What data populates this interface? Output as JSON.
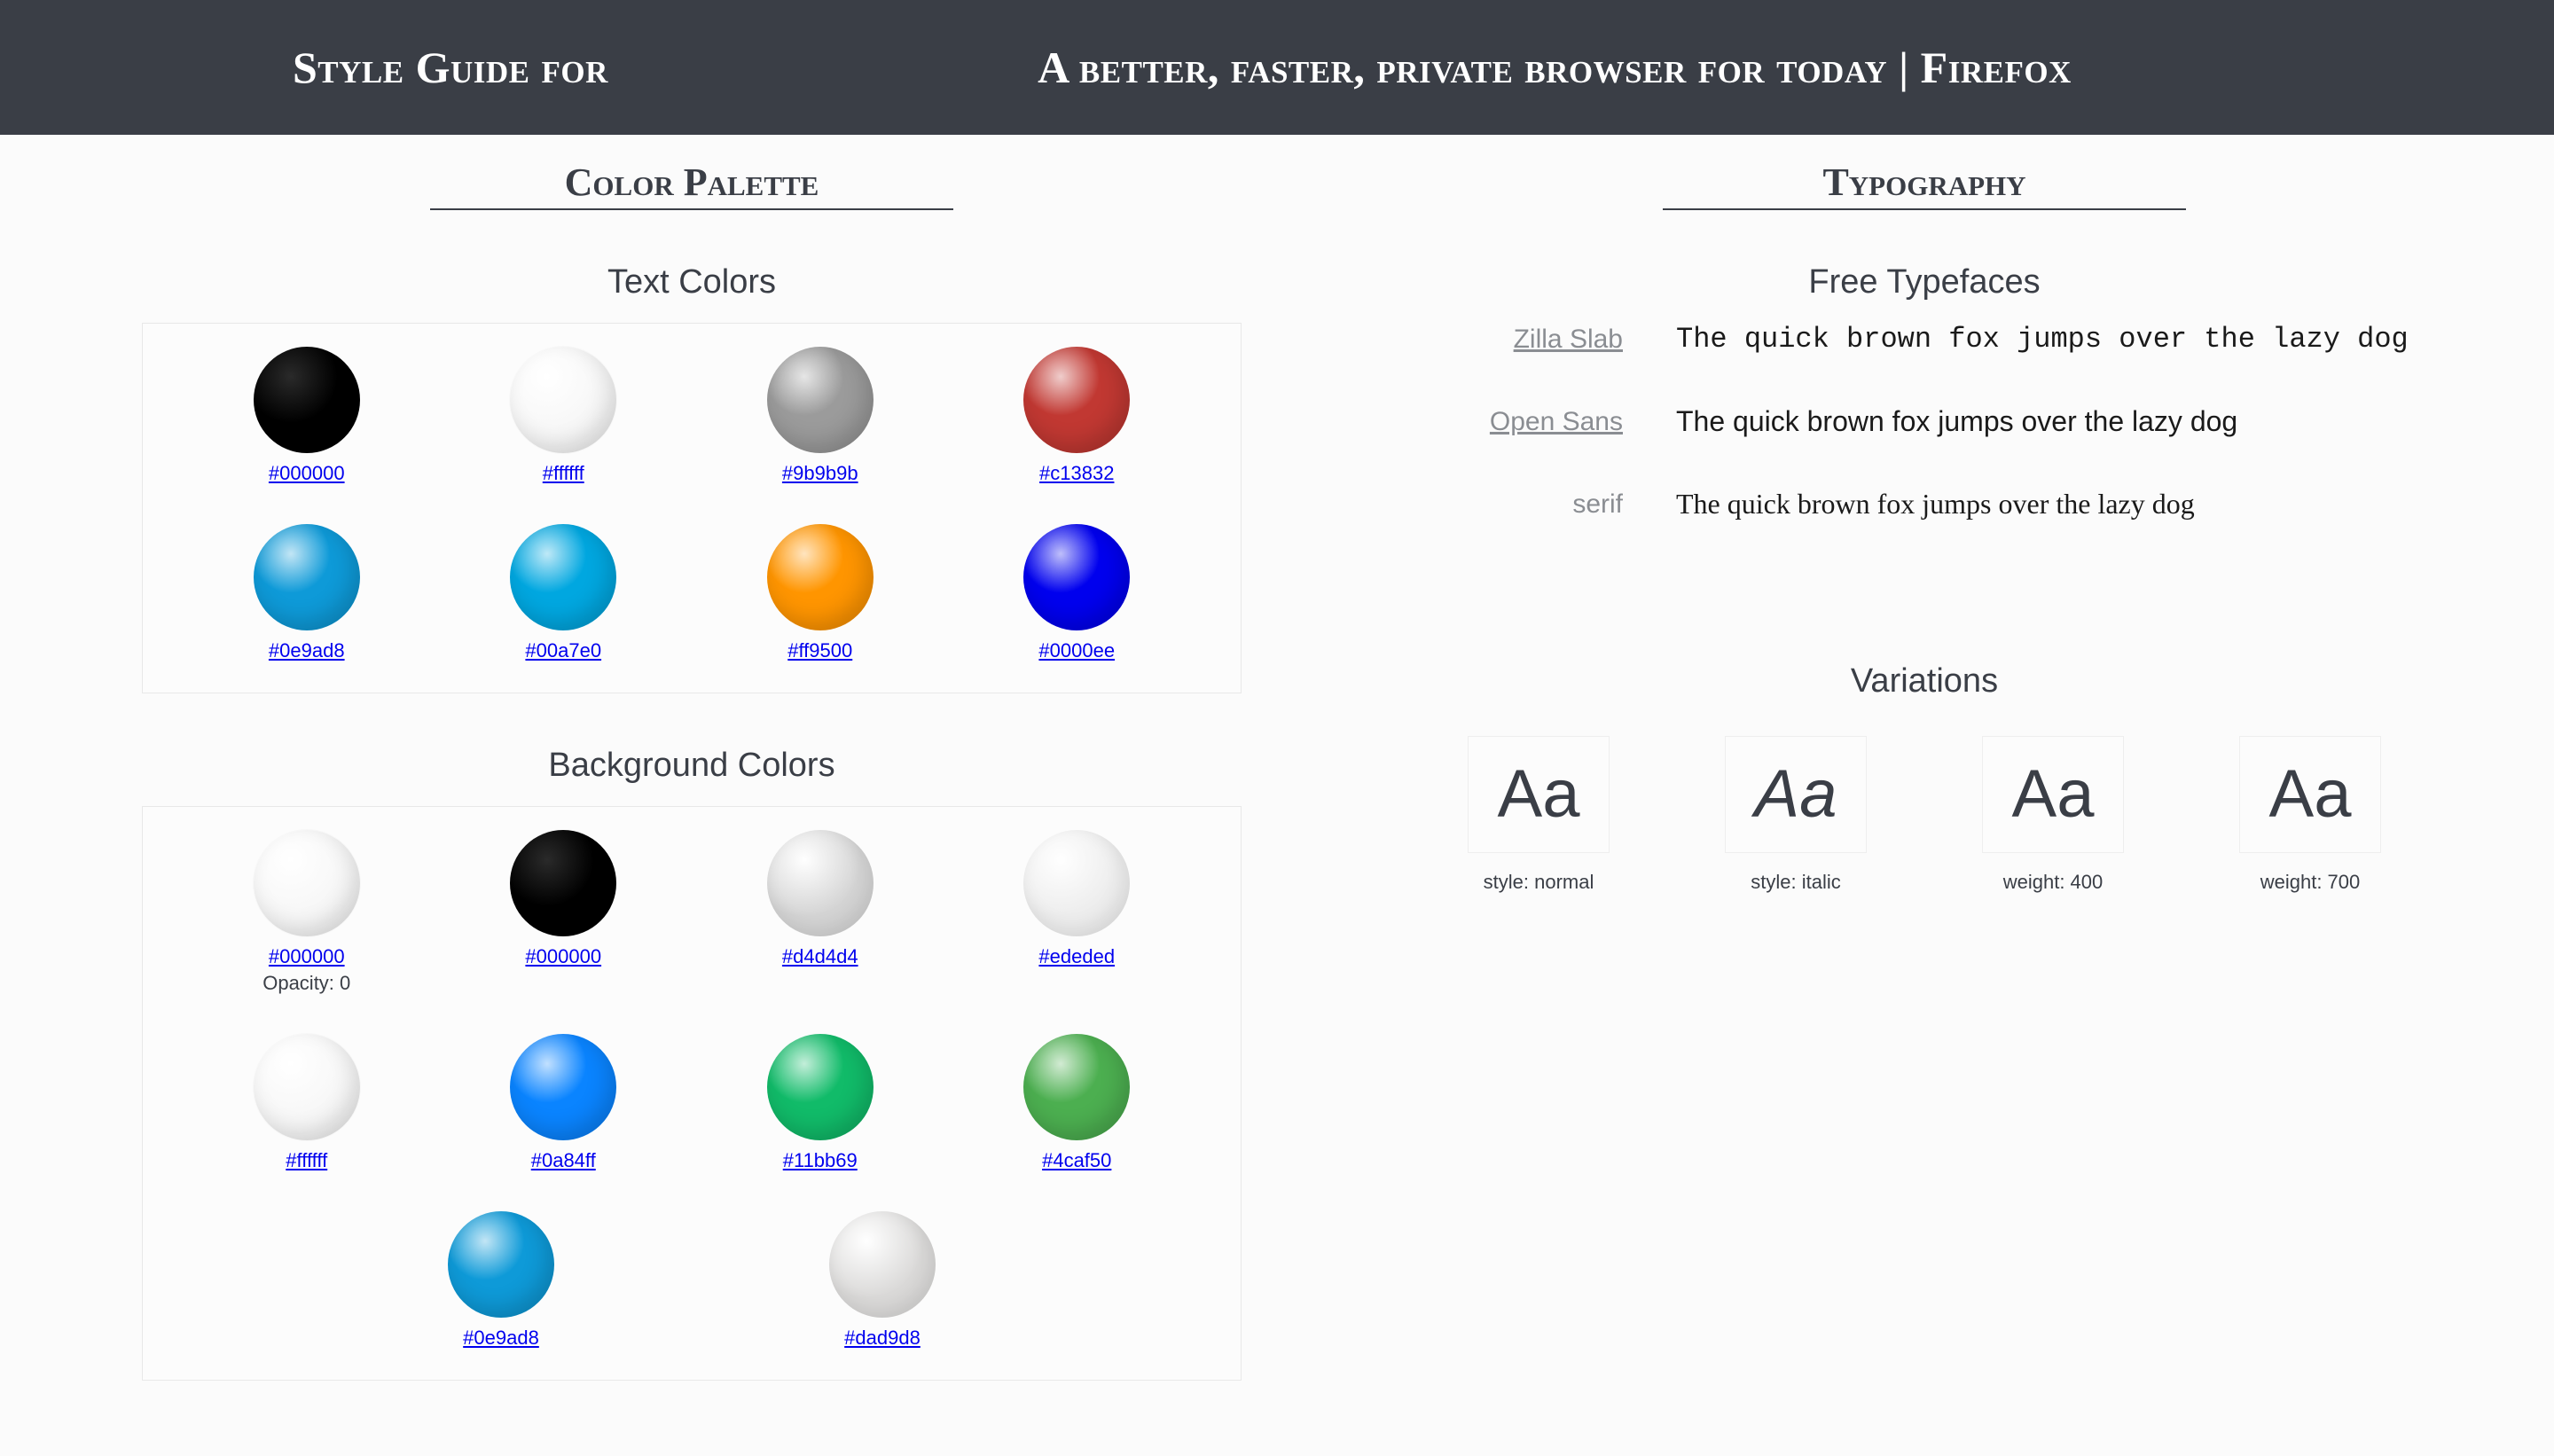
{
  "header": {
    "prefix": "Style Guide for",
    "site_title": "A better, faster, private browser for today | Firefox"
  },
  "palette": {
    "title": "Color Palette",
    "text_colors_title": "Text Colors",
    "text_colors": [
      {
        "hex": "#000000",
        "color": "#000000",
        "kind": "black"
      },
      {
        "hex": "#ffffff",
        "color": "#ffffff",
        "kind": "white"
      },
      {
        "hex": "#9b9b9b",
        "color": "#9b9b9b",
        "kind": "g"
      },
      {
        "hex": "#c13832",
        "color": "#c13832",
        "kind": "g"
      },
      {
        "hex": "#0e9ad8",
        "color": "#0e9ad8",
        "kind": "g"
      },
      {
        "hex": "#00a7e0",
        "color": "#00a7e0",
        "kind": "g"
      },
      {
        "hex": "#ff9500",
        "color": "#ff9500",
        "kind": "g"
      },
      {
        "hex": "#0000ee",
        "color": "#0000ee",
        "kind": "g"
      }
    ],
    "bg_colors_title": "Background Colors",
    "bg_colors_main": [
      {
        "hex": "#000000",
        "color": "#ffffff",
        "kind": "white",
        "opacity_note": "Opacity: 0"
      },
      {
        "hex": "#000000",
        "color": "#000000",
        "kind": "black"
      },
      {
        "hex": "#d4d4d4",
        "color": "#d4d4d4",
        "kind": "light"
      },
      {
        "hex": "#ededed",
        "color": "#ededed",
        "kind": "light"
      },
      {
        "hex": "#ffffff",
        "color": "#ffffff",
        "kind": "white"
      },
      {
        "hex": "#0a84ff",
        "color": "#0a84ff",
        "kind": "g"
      },
      {
        "hex": "#11bb69",
        "color": "#11bb69",
        "kind": "g"
      },
      {
        "hex": "#4caf50",
        "color": "#4caf50",
        "kind": "g"
      }
    ],
    "bg_colors_extra": [
      {
        "hex": "#0e9ad8",
        "color": "#0e9ad8",
        "kind": "g"
      },
      {
        "hex": "#dad9d8",
        "color": "#dad9d8",
        "kind": "light"
      }
    ]
  },
  "typography": {
    "title": "Typography",
    "free_title": "Free Typefaces",
    "pangram": "The quick brown fox jumps over the lazy dog",
    "faces": [
      {
        "name": "Zilla Slab",
        "link": true,
        "class": "sample-slab"
      },
      {
        "name": "Open Sans",
        "link": true,
        "class": "sample-sans"
      },
      {
        "name": "serif",
        "link": false,
        "class": "sample-serif"
      }
    ],
    "variations_title": "Variations",
    "variations_sample": "Aa",
    "variations": [
      {
        "label": "style: normal",
        "class": "w400"
      },
      {
        "label": "style: italic",
        "class": "italic w400"
      },
      {
        "label": "weight: 400",
        "class": "w400"
      },
      {
        "label": "weight: 700",
        "class": "w400"
      }
    ]
  }
}
